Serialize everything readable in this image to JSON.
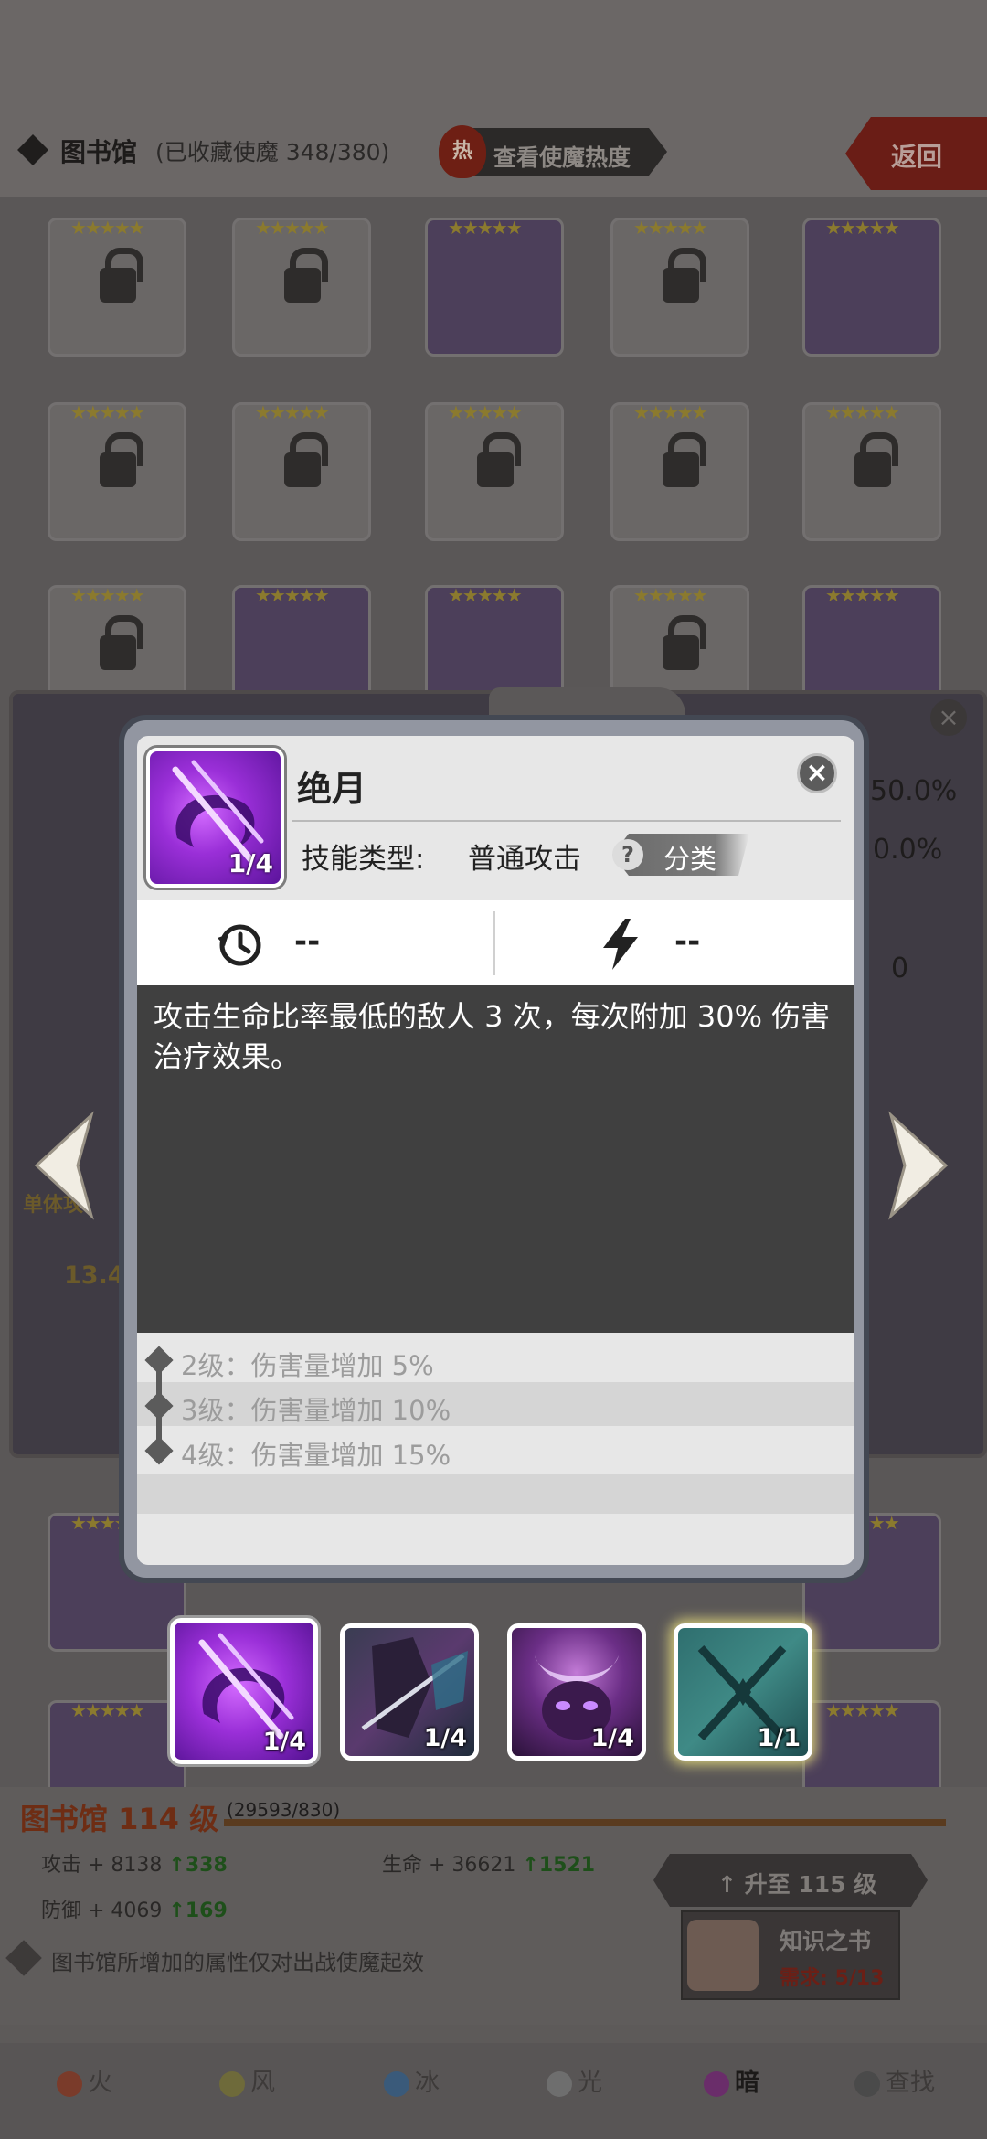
{
  "header": {
    "title": "图书馆",
    "collected": "(已收藏使魔 348/380)",
    "hot_badge": "热",
    "hot_button": "查看使魔热度",
    "back_button": "返回"
  },
  "side_panel": {
    "values": [
      "50.0%",
      "0.0%",
      "0"
    ],
    "left_texts": [
      "单体攻",
      "13.4"
    ]
  },
  "skill_dialog": {
    "name": "绝月",
    "icon_level": "1/4",
    "type_label": "技能类型:",
    "type_value": "普通攻击",
    "category_q": "?",
    "category_label": "分类",
    "cooldown_value": "--",
    "energy_value": "--",
    "description": "攻击生命比率最低的敌人 3 次，每次附加 30% 伤害治疗效果。",
    "levels": [
      "2级：伤害量增加 5%",
      "3级：伤害量增加 10%",
      "4级：伤害量增加 15%"
    ],
    "close": "×"
  },
  "skill_thumbs": [
    {
      "level": "1/4",
      "selected": true
    },
    {
      "level": "1/4",
      "selected": false
    },
    {
      "level": "1/4",
      "selected": false
    },
    {
      "level": "1/1",
      "selected": false
    }
  ],
  "library": {
    "level": "图书馆 114 级",
    "exp": "(29593/830)",
    "attack": "攻击 + 8138",
    "attack_up": "338",
    "hp": "生命 + 36621",
    "hp_up": "1521",
    "defense": "防御 + 4069",
    "defense_up": "169",
    "upgrade_button": "升至 115 级",
    "book_name": "知识之书",
    "book_req": "需求: 5/13",
    "note": "图书馆所增加的属性仅对出战使魔起效"
  },
  "element_tabs": [
    {
      "label": "火",
      "color": "#7a3b2a"
    },
    {
      "label": "风",
      "color": "#6e6a3a"
    },
    {
      "label": "冰",
      "color": "#3a5a7a"
    },
    {
      "label": "光",
      "color": "#6e6e6e"
    },
    {
      "label": "暗",
      "color": "#6a2d6a",
      "active": true
    },
    {
      "label": "查找",
      "color": "#4a4a4a"
    }
  ],
  "colors": {
    "skill_purple": "#9a2fd8",
    "dialog_frame": "#434853",
    "desc_bg": "#404040"
  }
}
